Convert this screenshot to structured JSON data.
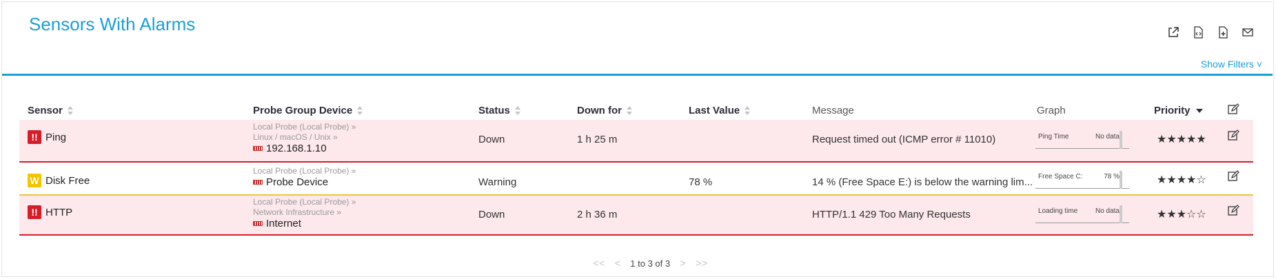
{
  "page_title": "Sensors With Alarms",
  "toolbar": {
    "icons": [
      "external-link-icon",
      "xml-icon",
      "add-report-icon",
      "email-icon"
    ]
  },
  "show_filters": "Show Filters ˅",
  "columns": {
    "sensor": "Sensor",
    "device": "Probe Group Device",
    "status": "Status",
    "down_for": "Down for",
    "last_value": "Last Value",
    "message": "Message",
    "graph": "Graph",
    "priority": "Priority"
  },
  "rows": [
    {
      "state": "down",
      "badge": "!!",
      "sensor": "Ping",
      "path1": "Local Probe (Local Probe) »",
      "path2": "Linux / macOS / Unix »",
      "device": "192.168.1.10",
      "status": "Down",
      "down_for": "1 h 25 m",
      "last_value": "",
      "message": "Request timed out (ICMP error # 11010)",
      "graph_label": "Ping Time",
      "graph_value": "No data",
      "priority": "★★★★★"
    },
    {
      "state": "warning",
      "badge": "W",
      "sensor": "Disk Free",
      "path1": "Local Probe (Local Probe) »",
      "path2": "",
      "device": "Probe Device",
      "status": "Warning",
      "down_for": "",
      "last_value": "78 %",
      "message": "14 % (Free Space E:) is below the warning lim...",
      "graph_label": "Free Space C:",
      "graph_value": "78 %",
      "priority": "★★★★☆"
    },
    {
      "state": "down",
      "badge": "!!",
      "sensor": "HTTP",
      "path1": "Local Probe (Local Probe) »",
      "path2": "Network Infrastructure »",
      "device": "Internet",
      "status": "Down",
      "down_for": "2 h 36 m",
      "last_value": "",
      "message": "HTTP/1.1 429 Too Many Requests",
      "graph_label": "Loading time",
      "graph_value": "No data",
      "priority": "★★★☆☆"
    }
  ],
  "pager": {
    "first": "<<",
    "prev": "<",
    "label": "1 to 3 of 3",
    "next": ">",
    "last": ">>"
  },
  "colors": {
    "accent": "#1a9ed8",
    "down_bg": "#fde8ec",
    "down_border": "#d51d2a",
    "warning": "#f5c400"
  }
}
